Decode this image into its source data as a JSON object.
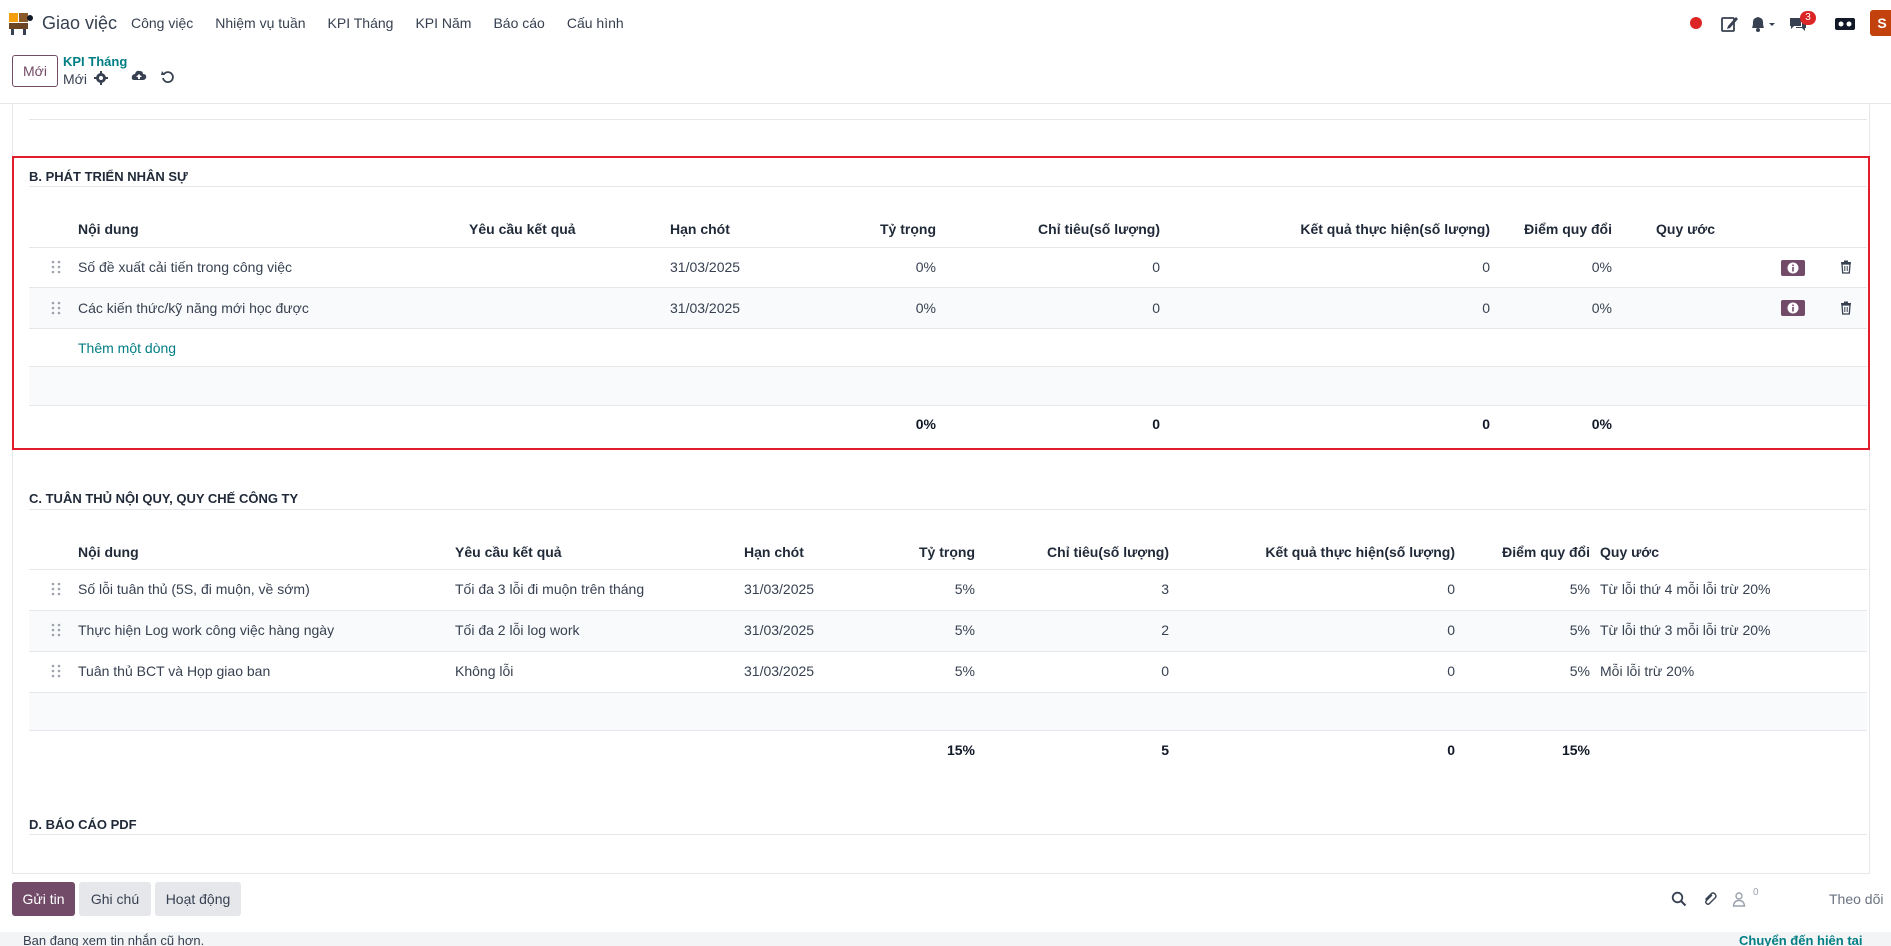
{
  "navbar": {
    "app_title": "Giao việc",
    "menu": [
      "Công việc",
      "Nhiệm vụ tuần",
      "KPI Tháng",
      "KPI Năm",
      "Báo cáo",
      "Cấu hình"
    ],
    "message_badge": "3",
    "avatar_initial": "S",
    "icons": [
      "recording-dot-icon",
      "edit-icon",
      "bell-icon",
      "chat-icon",
      "switch-company-icon"
    ]
  },
  "control_panel": {
    "new_button": "Mới",
    "breadcrumb": "KPI Tháng",
    "record_name": "Mới"
  },
  "section_b": {
    "title": "B. PHÁT TRIỂN NHÂN SỰ",
    "headers": [
      "Nội dung",
      "Yêu cầu kết quả",
      "Hạn chót",
      "Tỷ trọng",
      "Chỉ tiêu(số lượng)",
      "Kết quả thực hiện(số lượng)",
      "Điểm quy đổi",
      "Quy ước"
    ],
    "rows": [
      {
        "content": "Số đề xuất cải tiến trong công việc",
        "requirement": "",
        "deadline": "31/03/2025",
        "weight": "0%",
        "target": "0",
        "result": "0",
        "score": "0%",
        "rule": ""
      },
      {
        "content": "Các kiến thức/kỹ năng mới học được",
        "requirement": "",
        "deadline": "31/03/2025",
        "weight": "0%",
        "target": "0",
        "result": "0",
        "score": "0%",
        "rule": ""
      }
    ],
    "add_line": "Thêm một dòng",
    "totals": {
      "weight": "0%",
      "target": "0",
      "result": "0",
      "score": "0%"
    }
  },
  "section_c": {
    "title": "C. TUÂN THỦ NỘI QUY, QUY CHẾ CÔNG TY",
    "headers": [
      "Nội dung",
      "Yêu cầu kết quả",
      "Hạn chót",
      "Tỷ trọng",
      "Chỉ tiêu(số lượng)",
      "Kết quả thực hiện(số lượng)",
      "Điểm quy đổi",
      "Quy ước"
    ],
    "rows": [
      {
        "content": "Số lỗi tuân thủ (5S, đi muộn, về sớm)",
        "requirement": "Tối đa 3 lỗi đi muộn trên tháng",
        "deadline": "31/03/2025",
        "weight": "5%",
        "target": "3",
        "result": "0",
        "score": "5%",
        "rule": "Từ lỗi thứ 4 mỗi lỗi trừ 20%"
      },
      {
        "content": "Thực hiện Log work công việc hàng ngày",
        "requirement": "Tối đa 2 lỗi log work",
        "deadline": "31/03/2025",
        "weight": "5%",
        "target": "2",
        "result": "0",
        "score": "5%",
        "rule": "Từ lỗi thứ 3 mỗi lỗi trừ 20%"
      },
      {
        "content": "Tuân thủ BCT và Họp giao ban",
        "requirement": "Không lỗi",
        "deadline": "31/03/2025",
        "weight": "5%",
        "target": "0",
        "result": "0",
        "score": "5%",
        "rule": "Mỗi lỗi trừ 20%"
      }
    ],
    "totals": {
      "weight": "15%",
      "target": "5",
      "result": "0",
      "score": "15%"
    }
  },
  "section_d": {
    "title": "D. BÁO CÁO PDF"
  },
  "chatter": {
    "send_message": "Gửi tin",
    "log_note": "Ghi chú",
    "activity": "Hoạt động",
    "follower_count": "0",
    "follow": "Theo dõi",
    "old_messages": "Bạn đang xem tin nhắn cũ hơn.",
    "jump_to_present": "Chuyển đến hiện tại"
  },
  "colors": {
    "brand": "#714b67",
    "link": "#017e84",
    "highlight": "#e11d2b",
    "badge": "#dc2626"
  }
}
